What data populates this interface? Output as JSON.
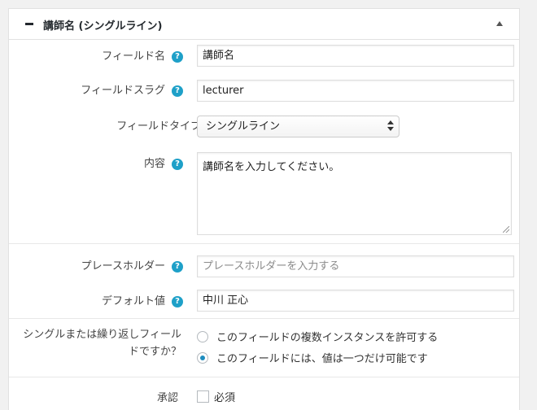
{
  "panel": {
    "title": "講師名 (シングルライン)"
  },
  "fields": {
    "field_name": {
      "label": "フィールド名",
      "value": "講師名"
    },
    "field_slug": {
      "label": "フィールドスラグ",
      "value": "lecturer"
    },
    "field_type": {
      "label": "フィールドタイプ",
      "selected": "シングルライン"
    },
    "content": {
      "label": "内容",
      "value": "講師名を入力してください。"
    },
    "placeholder": {
      "label": "プレースホルダー",
      "placeholder": "プレースホルダーを入力する"
    },
    "default_value": {
      "label": "デフォルト値",
      "value": "中川 正心"
    },
    "repeat_mode": {
      "label": "シングルまたは繰り返しフィールドですか？",
      "options": [
        {
          "label": "このフィールドの複数インスタンスを許可する",
          "checked": false
        },
        {
          "label": "このフィールドには、値は一つだけ可能です",
          "checked": true
        }
      ]
    },
    "validation": {
      "label": "承認",
      "checkbox_label": "必須"
    }
  },
  "help_icon_glyph": "?",
  "colors": {
    "help_icon": "#1ea0c8",
    "radio_checked": "#1e8cbe"
  }
}
